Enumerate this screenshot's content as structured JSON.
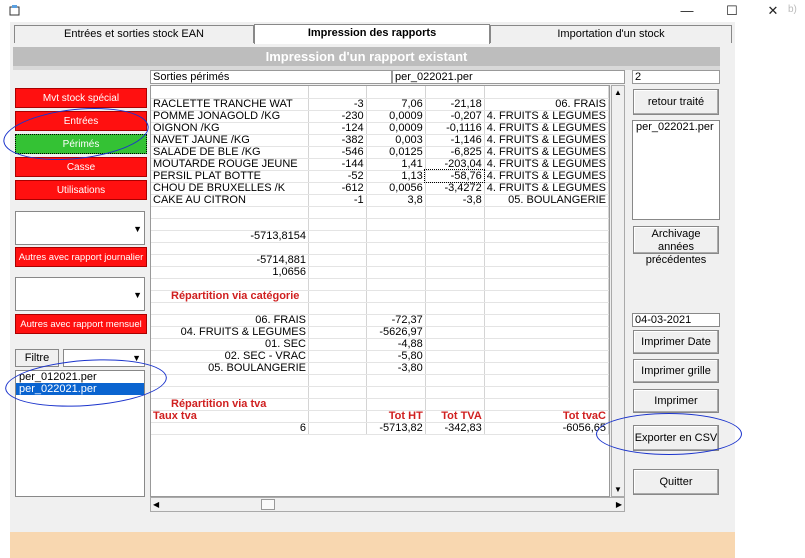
{
  "window": {
    "minimize": "—",
    "maximize": "☐",
    "close": "✕",
    "behind_text": "b)"
  },
  "tabs": [
    "Entrées et sorties stock EAN",
    "Impression des rapports",
    "Importation d'un stock"
  ],
  "banner": "Impression d'un rapport existant",
  "left": {
    "buttons": [
      "Mvt stock spécial",
      "Entrées",
      "Périmés",
      "Casse",
      "Utilisations"
    ],
    "daily_button": "Autres avec rapport journalier",
    "monthly_button": "Autres avec rapport mensuel",
    "filter_label": "Filtre",
    "files": [
      "per_012021.per",
      "per_022021.per"
    ],
    "selected_file": 1
  },
  "header": {
    "report_name": "Sorties périmés",
    "file_name": "per_022021.per",
    "count": "2"
  },
  "grid_rows": [
    [
      "",
      "",
      "",
      "",
      ""
    ],
    [
      "RACLETTE TRANCHE WAT",
      "-3",
      "7,06",
      "-21,18",
      "06. FRAIS"
    ],
    [
      "POMME JONAGOLD /KG",
      "-230",
      "0,0009",
      "-0,207",
      "4. FRUITS & LEGUMES"
    ],
    [
      "OIGNON /KG",
      "-124",
      "0,0009",
      "-0,1116",
      "4. FRUITS & LEGUMES"
    ],
    [
      "NAVET JAUNE /KG",
      "-382",
      "0,003",
      "-1,146",
      "4. FRUITS & LEGUMES"
    ],
    [
      "SALADE DE BLE /KG",
      "-546",
      "0,0125",
      "-6,825",
      "4. FRUITS & LEGUMES"
    ],
    [
      "MOUTARDE ROUGE JEUNE",
      "-144",
      "1,41",
      "-203,04",
      "4. FRUITS & LEGUMES"
    ],
    [
      "PERSIL PLAT BOTTE",
      "-52",
      "1,13",
      "-58,76",
      "4. FRUITS & LEGUMES"
    ],
    [
      "CHOU DE BRUXELLES /K",
      "-612",
      "0,0056",
      "-3,4272",
      "4. FRUITS & LEGUMES"
    ],
    [
      "CAKE AU CITRON",
      "-1",
      "3,8",
      "-3,8",
      "05. BOULANGERIE"
    ],
    [
      "",
      "",
      "",
      "",
      ""
    ],
    [
      "",
      "",
      "",
      "",
      ""
    ],
    [
      "-5713,8154",
      "",
      "",
      "",
      ""
    ],
    [
      "",
      "",
      "",
      "",
      ""
    ],
    [
      "-5714,881",
      "",
      "",
      "",
      ""
    ],
    [
      "1,0656",
      "",
      "",
      "",
      ""
    ],
    [
      "",
      "",
      "",
      "",
      ""
    ],
    [
      "Répartition via catégorie",
      "",
      "",
      "",
      ""
    ],
    [
      "",
      "",
      "",
      "",
      ""
    ],
    [
      "06. FRAIS",
      "",
      "-72,37",
      "",
      ""
    ],
    [
      "04. FRUITS & LEGUMES",
      "",
      "-5626,97",
      "",
      ""
    ],
    [
      "01. SEC",
      "",
      "-4,88",
      "",
      ""
    ],
    [
      "02. SEC - VRAC",
      "",
      "-5,80",
      "",
      ""
    ],
    [
      "05. BOULANGERIE",
      "",
      "-3,80",
      "",
      ""
    ],
    [
      "",
      "",
      "",
      "",
      ""
    ],
    [
      "",
      "",
      "",
      "",
      ""
    ],
    [
      "Répartition via tva",
      "",
      "",
      "",
      ""
    ],
    [
      "Taux tva",
      "",
      "Tot HT",
      "Tot TVA",
      "Tot tvaC"
    ],
    [
      "6",
      "",
      "-5713,82",
      "-342,83",
      "-6056,65"
    ]
  ],
  "right": {
    "retour_button": "retour traité",
    "files": [
      "per_022021.per"
    ],
    "archive_button": "Archivage années précédentes",
    "date_value": "04-03-2021",
    "print_date_button": "Imprimer Date",
    "print_grid_button": "Imprimer grille",
    "print_button": "Imprimer",
    "export_button": "Exporter en CSV",
    "quit_button": "Quitter"
  },
  "colors": {
    "red_button": "#ff1010",
    "green_button": "#34c234",
    "annotation": "#1a33cc",
    "orange_strip": "#f8d7b0"
  }
}
